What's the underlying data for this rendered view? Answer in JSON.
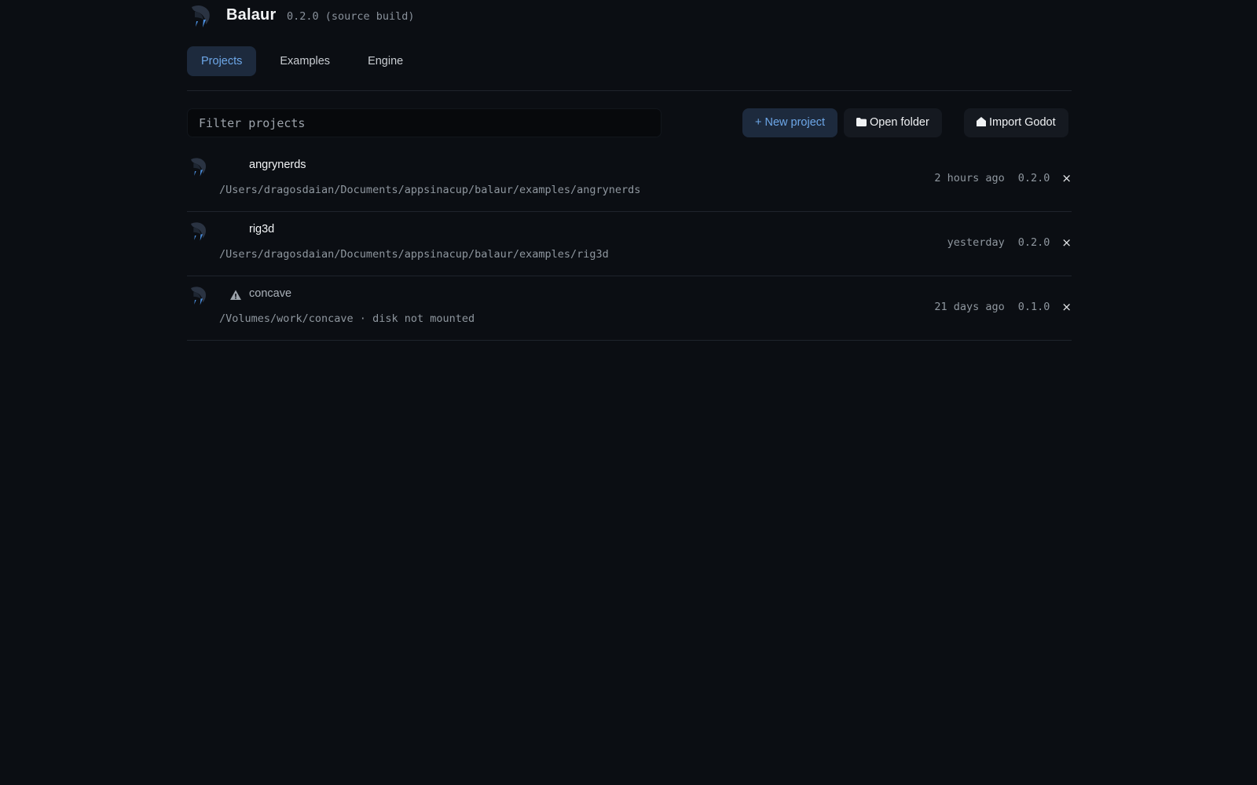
{
  "app": {
    "name": "Balaur",
    "version": "0.2.0 (source build)"
  },
  "tabs": [
    {
      "label": "Projects",
      "active": true
    },
    {
      "label": "Examples",
      "active": false
    },
    {
      "label": "Engine",
      "active": false
    }
  ],
  "toolbar": {
    "filter_placeholder": "Filter projects",
    "filter_value": "",
    "new_project_label": "+ New project",
    "open_folder_label": "Open folder",
    "import_godot_label": "Import Godot"
  },
  "projects": [
    {
      "name": "angrynerds",
      "path": "/Users/dragosdaian/Documents/appsinacup/balaur/examples/angrynerds",
      "last_opened": "2 hours ago",
      "version": "0.2.0",
      "remove_label": "×",
      "missing": false
    },
    {
      "name": "rig3d",
      "path": "/Users/dragosdaian/Documents/appsinacup/balaur/examples/rig3d",
      "last_opened": "yesterday",
      "version": "0.2.0",
      "remove_label": "×",
      "missing": false
    },
    {
      "name": "concave",
      "path": "/Volumes/work/concave  ·  disk not mounted",
      "last_opened": "21 days ago",
      "version": "0.1.0",
      "remove_label": "×",
      "missing": true
    }
  ],
  "icons": {
    "logo": "balaur-logo-icon",
    "open_folder": "folder-icon",
    "import_godot": "home-icon",
    "warning": "warning-icon"
  },
  "colors": {
    "background": "#0b0e13",
    "accent": "#6da7e8",
    "accent_bg": "#1d2a3d",
    "muted_text": "#8f979f"
  }
}
